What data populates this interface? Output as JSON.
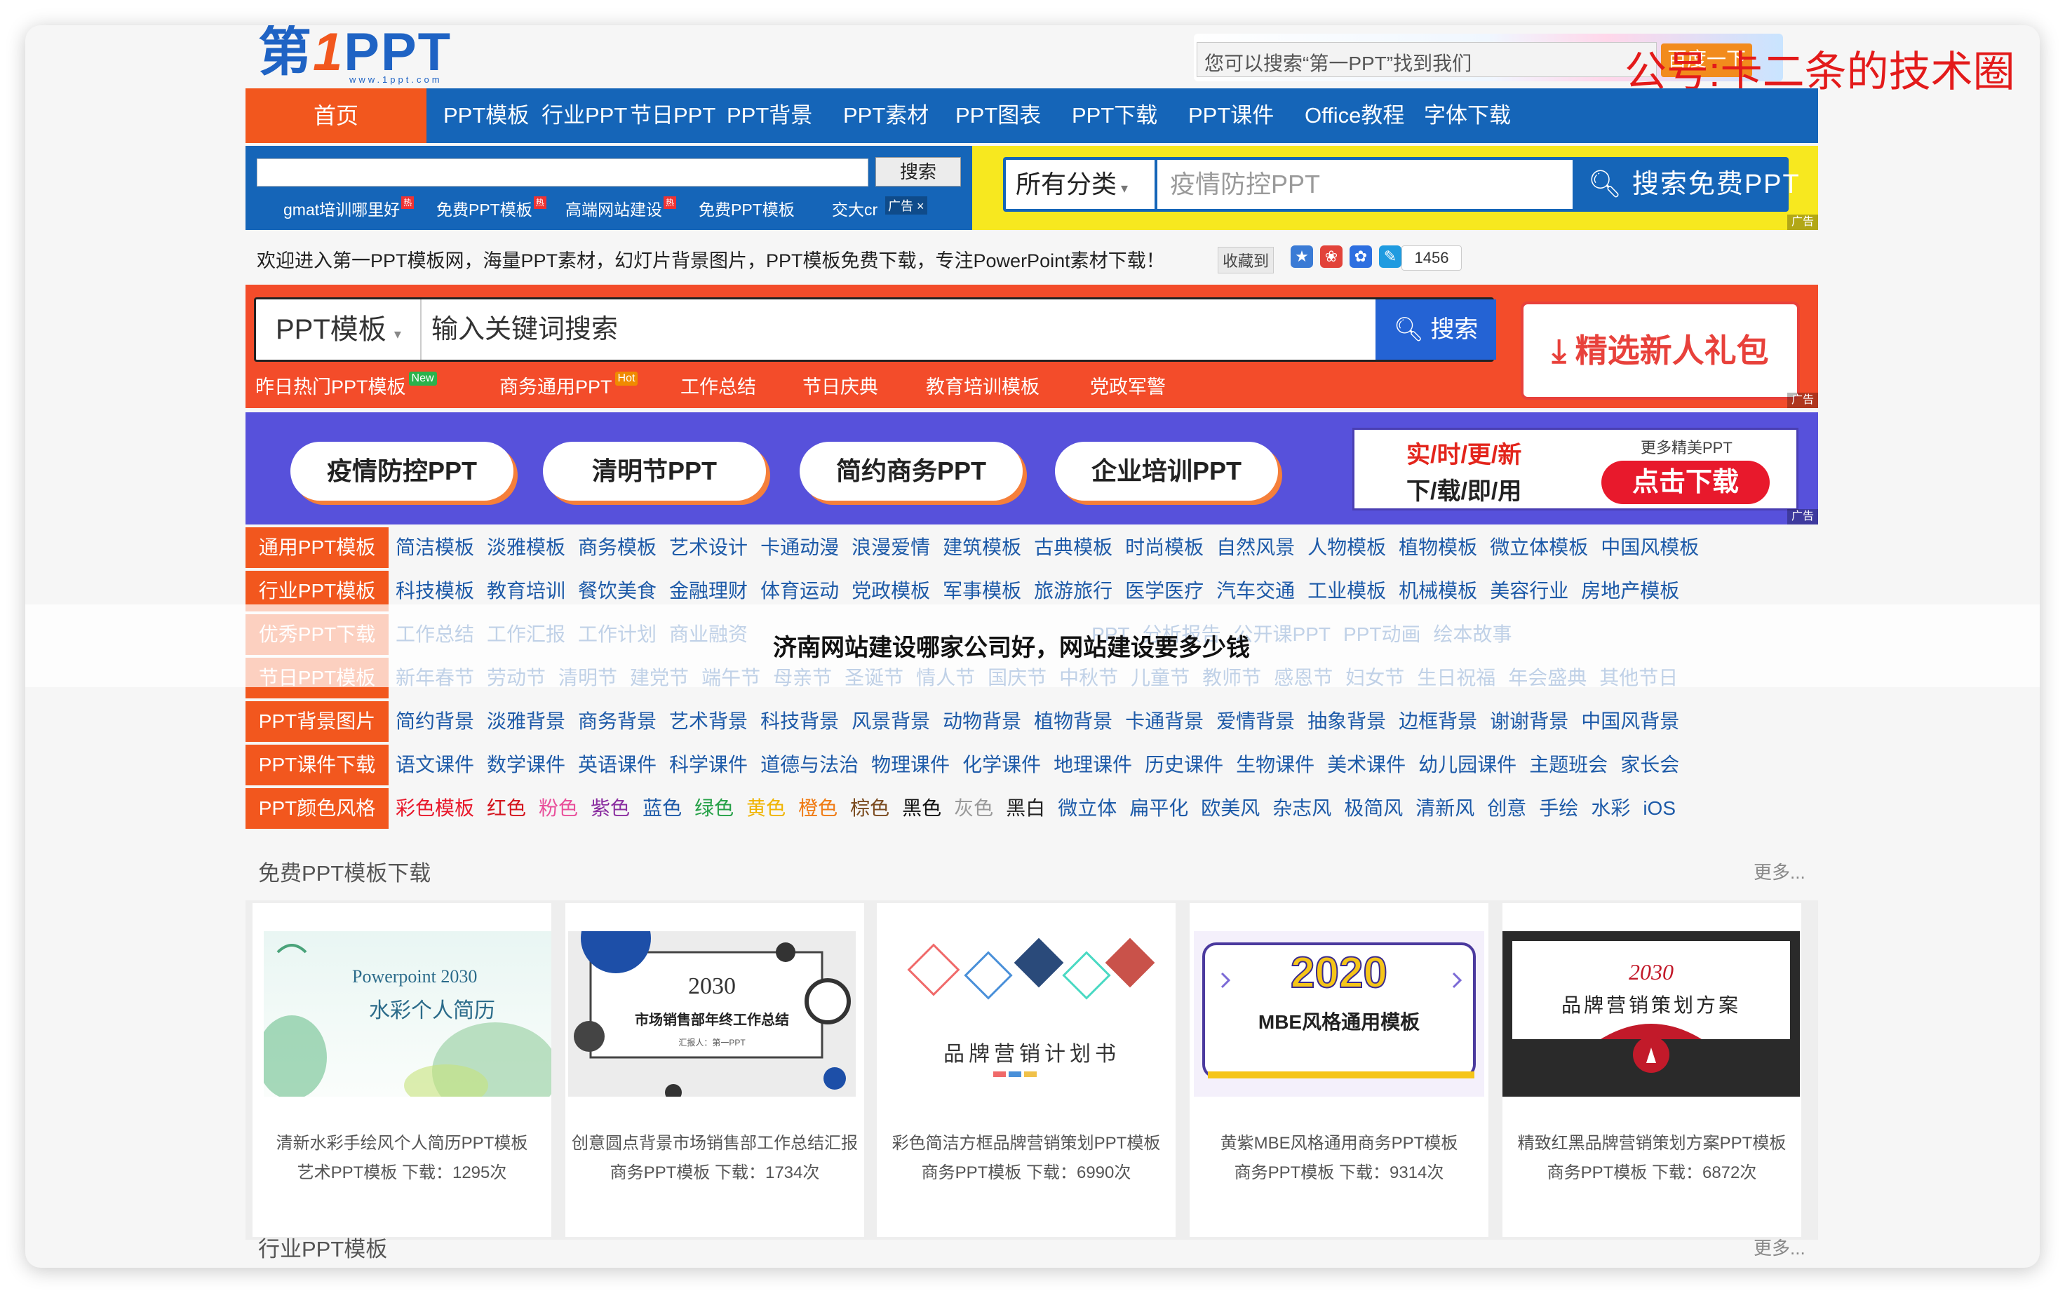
{
  "logo": {
    "main_prefix": "第",
    "main_one": "1",
    "main_suffix": "PPT",
    "sub": "www.1ppt.com"
  },
  "top_search": {
    "placeholder": "您可以搜索“第一PPT”找到我们",
    "button": "百度一下"
  },
  "watermark": "公号:卡二条的技术圈",
  "nav": {
    "home": "首页",
    "items": [
      "PPT模板",
      "行业PPT",
      "节日PPT",
      "PPT背景",
      "PPT素材",
      "PPT图表",
      "PPT下载",
      "PPT课件",
      "Office教程",
      "字体下载"
    ]
  },
  "bar2": {
    "search_button": "搜索",
    "links": [
      "gmat培训哪里好",
      "免费PPT模板",
      "高端网站建设",
      "免费PPT模板",
      "交大cr"
    ],
    "hot_mark": "热",
    "close_label": "广告 ×",
    "category": "所有分类",
    "placeholder": "疫情防控PPT",
    "big_search_button": "搜索免费PPT",
    "ad_tag": "广告"
  },
  "welcome": {
    "text": "欢迎进入第一PPT模板网，海量PPT素材，幻灯片背景图片，PPT模板免费下载，专注PowerPoint素材下载！",
    "fav_label": "收藏到",
    "count": "1456"
  },
  "bar3": {
    "category": "PPT模板",
    "placeholder": "输入关键词搜索",
    "search_button": "搜索",
    "gift": "精选新人礼包",
    "links": [
      "昨日热门PPT模板",
      "商务通用PPT",
      "工作总结",
      "节日庆典",
      "教育培训模板",
      "党政军警"
    ],
    "badge_new": "New",
    "badge_hot": "Hot",
    "ad_tag": "广告"
  },
  "bar4": {
    "pills": [
      "疫情防控PPT",
      "清明节PPT",
      "简约商务PPT",
      "企业培训PPT"
    ],
    "ad_line1": "实/时/更/新",
    "ad_line2": "下/载/即/用",
    "ad_more": "更多精美PPT",
    "ad_button": "点击下载",
    "ad_tag": "广告"
  },
  "category_rows": [
    {
      "head": "通用PPT模板",
      "links": [
        "简洁模板",
        "淡雅模板",
        "商务模板",
        "艺术设计",
        "卡通动漫",
        "浪漫爱情",
        "建筑模板",
        "古典模板",
        "时尚模板",
        "自然风景",
        "人物模板",
        "植物模板",
        "微立体模板",
        "中国风模板"
      ]
    },
    {
      "head": "行业PPT模板",
      "links": [
        "科技模板",
        "教育培训",
        "餐饮美食",
        "金融理财",
        "体育运动",
        "党政模板",
        "军事模板",
        "旅游旅行",
        "医学医疗",
        "汽车交通",
        "工业模板",
        "机械模板",
        "美容行业",
        "房地产模板"
      ]
    },
    {
      "head": "优秀PPT下载",
      "links": [
        "工作总结",
        "工作汇报",
        "工作计划",
        "商业融资",
        "",
        "",
        "",
        "",
        "PPT",
        "分析报告",
        "公开课PPT",
        "PPT动画",
        "绘本故事"
      ]
    },
    {
      "head": "节日PPT模板",
      "links": [
        "新年春节",
        "劳动节",
        "清明节",
        "建党节",
        "端午节",
        "母亲节",
        "圣诞节",
        "情人节",
        "国庆节",
        "中秋节",
        "儿童节",
        "教师节",
        "感恩节",
        "妇女节",
        "生日祝福",
        "年会盛典",
        "其他节日"
      ]
    },
    {
      "head": "PPT背景图片",
      "links": [
        "简约背景",
        "淡雅背景",
        "商务背景",
        "艺术背景",
        "科技背景",
        "风景背景",
        "动物背景",
        "植物背景",
        "卡通背景",
        "爱情背景",
        "抽象背景",
        "边框背景",
        "谢谢背景",
        "中国风背景"
      ]
    },
    {
      "head": "PPT课件下载",
      "links": [
        "语文课件",
        "数学课件",
        "英语课件",
        "科学课件",
        "道德与法治",
        "物理课件",
        "化学课件",
        "地理课件",
        "历史课件",
        "生物课件",
        "美术课件",
        "幼儿园课件",
        "主题班会",
        "家长会"
      ]
    },
    {
      "head": "PPT颜色风格",
      "links": [
        "彩色模板",
        "红色",
        "粉色",
        "紫色",
        "蓝色",
        "绿色",
        "黄色",
        "橙色",
        "棕色",
        "黑色",
        "灰色",
        "黑白",
        "微立体",
        "扁平化",
        "欧美风",
        "杂志风",
        "极简风",
        "清新风",
        "创意",
        "手绘",
        "水彩",
        "iOS"
      ]
    }
  ],
  "color_links": [
    "#e8192c",
    "#d4141d",
    "#e94e9a",
    "#8a2ea0",
    "#1d5aa8",
    "#25a046",
    "#f0b400",
    "#f07a12",
    "#7a4a1e",
    "#111111",
    "#999999",
    "#222222"
  ],
  "headline": "济南网站建设哪家公司好，网站建设要多少钱",
  "section": {
    "title": "免费PPT模板下载",
    "more": "更多..."
  },
  "cards": [
    {
      "thumb_title": "Powerpoint 2030",
      "thumb_sub": "水彩个人简历",
      "title": "清新水彩手绘风个人简历PPT模板",
      "meta": "艺术PPT模板   下载：1295次"
    },
    {
      "thumb_title": "2030",
      "thumb_sub": "市场销售部年终工作总结",
      "thumb_small": "汇报人：第一PPT",
      "title": "创意圆点背景市场销售部工作总结汇报",
      "meta": "商务PPT模板   下载：1734次"
    },
    {
      "thumb_title": "品牌营销计划书",
      "thumb_sub": "",
      "title": "彩色简洁方框品牌营销策划PPT模板",
      "meta": "商务PPT模板   下载：6990次"
    },
    {
      "thumb_title": "2020",
      "thumb_sub": "MBE风格通用模板",
      "title": "黄紫MBE风格通用商务PPT模板",
      "meta": "商务PPT模板   下载：9314次"
    },
    {
      "thumb_title": "2030",
      "thumb_sub": "品牌营销策划方案",
      "title": "精致红黑品牌营销策划方案PPT模板",
      "meta": "商务PPT模板   下载：6872次"
    }
  ],
  "section2": {
    "title": "行业PPT模板",
    "more": "更多..."
  }
}
